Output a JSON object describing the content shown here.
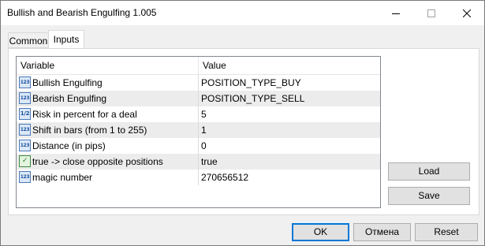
{
  "window": {
    "title": "Bullish and Bearish Engulfing 1.005"
  },
  "tabs": [
    {
      "label": "Common",
      "active": false
    },
    {
      "label": "Inputs",
      "active": true
    }
  ],
  "table": {
    "columns": [
      "Variable",
      "Value"
    ],
    "rows": [
      {
        "icon": "123",
        "variable": "Bullish Engulfing",
        "value": "POSITION_TYPE_BUY"
      },
      {
        "icon": "123",
        "variable": "Bearish Engulfing",
        "value": "POSITION_TYPE_SELL"
      },
      {
        "icon": "1/2",
        "variable": "Risk in percent for a deal",
        "value": "5"
      },
      {
        "icon": "123",
        "variable": "Shift in bars (from 1 to 255)",
        "value": "1"
      },
      {
        "icon": "123",
        "variable": "Distance (in pips)",
        "value": "0"
      },
      {
        "icon": "bool",
        "variable": "true -> close opposite positions",
        "value": "true"
      },
      {
        "icon": "123",
        "variable": "magic number",
        "value": "270656512"
      }
    ]
  },
  "side_buttons": {
    "load": "Load",
    "save": "Save"
  },
  "footer_buttons": {
    "ok": "OK",
    "cancel": "Отмена",
    "reset": "Reset"
  },
  "colors": {
    "accent": "#0078d7",
    "row_alt": "#ececec"
  }
}
